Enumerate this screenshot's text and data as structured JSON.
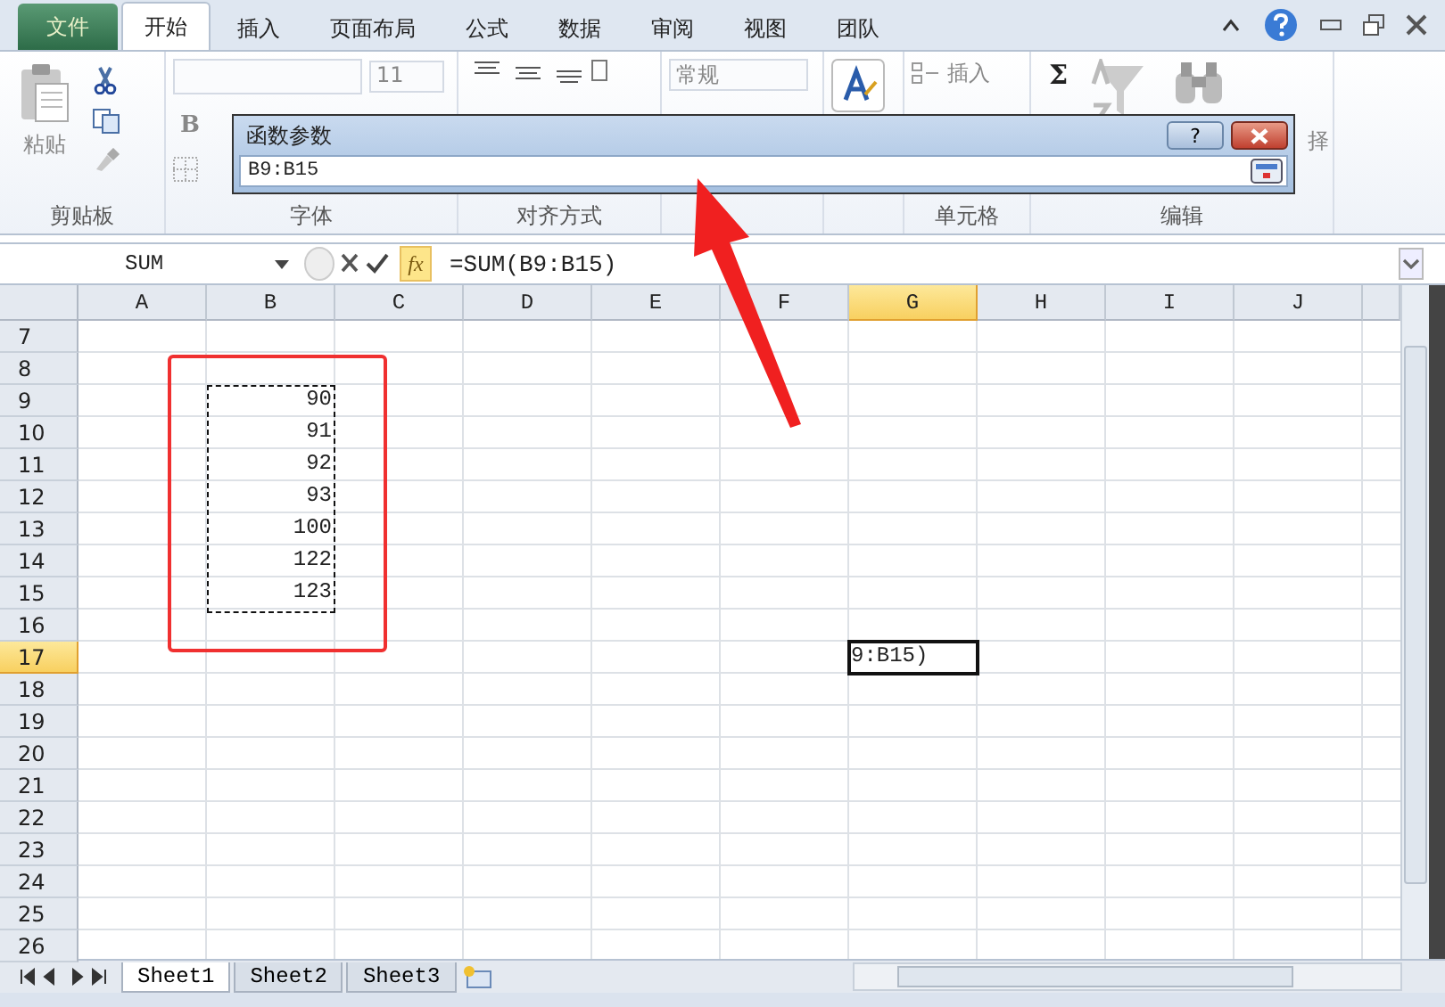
{
  "tabs": [
    {
      "label": "文件",
      "kind": "file",
      "selected": false
    },
    {
      "label": "开始",
      "kind": "tab",
      "selected": true
    },
    {
      "label": "插入",
      "kind": "tab",
      "selected": false
    },
    {
      "label": "页面布局",
      "kind": "tab",
      "selected": false
    },
    {
      "label": "公式",
      "kind": "tab",
      "selected": false
    },
    {
      "label": "数据",
      "kind": "tab",
      "selected": false
    },
    {
      "label": "审阅",
      "kind": "tab",
      "selected": false
    },
    {
      "label": "视图",
      "kind": "tab",
      "selected": false
    },
    {
      "label": "团队",
      "kind": "tab",
      "selected": false
    }
  ],
  "ribbon": {
    "paste": "粘贴",
    "font_size": "11",
    "bold": "B",
    "number_format": "常规",
    "insert": "插入",
    "sum": "Σ",
    "find_partial": "择",
    "groups": [
      "剪贴板",
      "字体",
      "对齐方式",
      "单元格",
      "编辑"
    ]
  },
  "dialog": {
    "title": "函数参数",
    "value": "B9:B15",
    "help": "?"
  },
  "formula_bar": {
    "name_box": "SUM",
    "fx": "fx",
    "formula": "=SUM(B9:B15)"
  },
  "columns": [
    {
      "label": "A",
      "selected": false
    },
    {
      "label": "B",
      "selected": false
    },
    {
      "label": "C",
      "selected": false
    },
    {
      "label": "D",
      "selected": false
    },
    {
      "label": "E",
      "selected": false
    },
    {
      "label": "F",
      "selected": false
    },
    {
      "label": "G",
      "selected": true
    },
    {
      "label": "H",
      "selected": false
    },
    {
      "label": "I",
      "selected": false
    },
    {
      "label": "J",
      "selected": false
    }
  ],
  "rows": [
    {
      "label": "7",
      "selected": false
    },
    {
      "label": "8",
      "selected": false
    },
    {
      "label": "9",
      "selected": false,
      "b": "90"
    },
    {
      "label": "10",
      "selected": false,
      "b": "91"
    },
    {
      "label": "11",
      "selected": false,
      "b": "92"
    },
    {
      "label": "12",
      "selected": false,
      "b": "93"
    },
    {
      "label": "13",
      "selected": false,
      "b": "100"
    },
    {
      "label": "14",
      "selected": false,
      "b": "122"
    },
    {
      "label": "15",
      "selected": false,
      "b": "123"
    },
    {
      "label": "16",
      "selected": false
    },
    {
      "label": "17",
      "selected": true,
      "g": "9:B15)"
    },
    {
      "label": "18",
      "selected": false
    },
    {
      "label": "19",
      "selected": false
    },
    {
      "label": "20",
      "selected": false
    },
    {
      "label": "21",
      "selected": false
    },
    {
      "label": "22",
      "selected": false
    },
    {
      "label": "23",
      "selected": false
    },
    {
      "label": "24",
      "selected": false
    },
    {
      "label": "25",
      "selected": false
    },
    {
      "label": "26",
      "selected": false
    }
  ],
  "sheets": [
    {
      "label": "Sheet1",
      "selected": true
    },
    {
      "label": "Sheet2",
      "selected": false
    },
    {
      "label": "Sheet3",
      "selected": false
    }
  ]
}
